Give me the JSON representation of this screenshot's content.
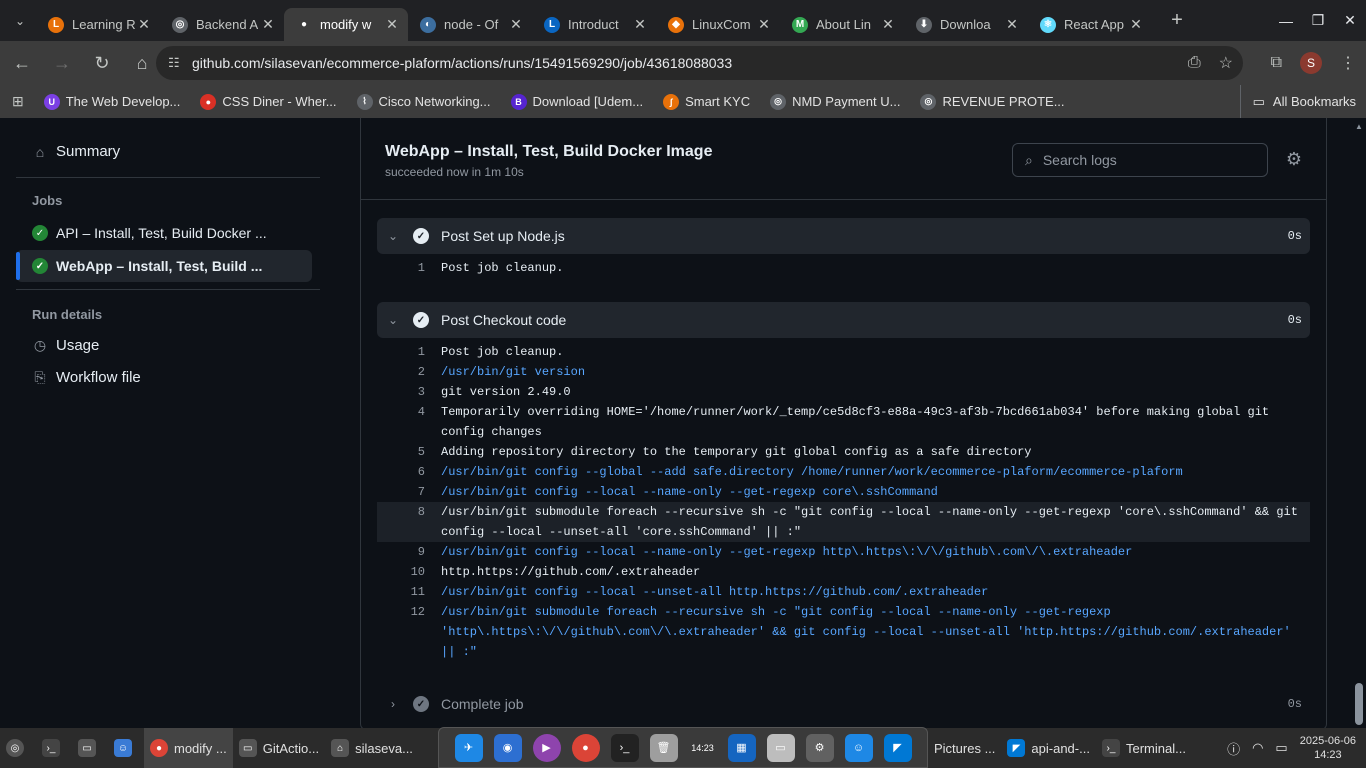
{
  "browser": {
    "tabs": [
      {
        "title": "Learning R",
        "color": "#e8710a",
        "glyph": "L",
        "active": false
      },
      {
        "title": "Backend A",
        "color": "#5f6368",
        "glyph": "◎",
        "active": false
      },
      {
        "title": "modify w",
        "color": "#ffffff",
        "glyph": "●",
        "active": true
      },
      {
        "title": "node - Of",
        "color": "#3c6e9f",
        "glyph": "◐",
        "active": false
      },
      {
        "title": "Introduct",
        "color": "#0a66c2",
        "glyph": "L",
        "active": false
      },
      {
        "title": "LinuxCom",
        "color": "#e8710a",
        "glyph": "◆",
        "active": false
      },
      {
        "title": "About Lin",
        "color": "#34a853",
        "glyph": "M",
        "active": false
      },
      {
        "title": "Downloa",
        "color": "#5f6368",
        "glyph": "⬇",
        "active": false
      },
      {
        "title": "React App",
        "color": "#61dafb",
        "glyph": "⚛",
        "active": false
      }
    ],
    "url": "github.com/silasevan/ecommerce-plaform/actions/runs/15491569290/job/43618088033",
    "profile_initial": "S",
    "bookmarks": [
      {
        "label": "The Web Develop...",
        "color": "#7b3fe4",
        "glyph": "U"
      },
      {
        "label": "CSS Diner - Wher...",
        "color": "#d93025",
        "glyph": "●"
      },
      {
        "label": "Cisco Networking...",
        "color": "#5f6368",
        "glyph": "⌇"
      },
      {
        "label": "Download [Udem...",
        "color": "#5624d0",
        "glyph": "B"
      },
      {
        "label": "Smart KYC",
        "color": "#e8710a",
        "glyph": "∫"
      },
      {
        "label": "NMD Payment U...",
        "color": "#5f6368",
        "glyph": "◎"
      },
      {
        "label": "REVENUE PROTE...",
        "color": "#5f6368",
        "glyph": "◎"
      }
    ],
    "all_bookmarks": "All Bookmarks"
  },
  "sidebar": {
    "summary": "Summary",
    "jobs_heading": "Jobs",
    "jobs": [
      {
        "label": "API – Install, Test, Build Docker ...",
        "selected": false
      },
      {
        "label": "WebApp – Install, Test, Build ...",
        "selected": true
      }
    ],
    "run_details_heading": "Run details",
    "usage": "Usage",
    "workflow_file": "Workflow file"
  },
  "job": {
    "title": "WebApp – Install, Test, Build Docker Image",
    "status": "succeeded now in 1m 10s",
    "search_placeholder": "Search logs"
  },
  "steps": [
    {
      "name": "Post Set up Node.js",
      "duration": "0s",
      "expanded": true,
      "lines": [
        {
          "n": "1",
          "text": "Post job cleanup.",
          "cmd": false
        }
      ]
    },
    {
      "name": "Post Checkout code",
      "duration": "0s",
      "expanded": true,
      "lines": [
        {
          "n": "1",
          "text": "Post job cleanup.",
          "cmd": false
        },
        {
          "n": "2",
          "text": "/usr/bin/git version",
          "cmd": true
        },
        {
          "n": "3",
          "text": "git version 2.49.0",
          "cmd": false
        },
        {
          "n": "4",
          "text": "Temporarily overriding HOME='/home/runner/work/_temp/ce5d8cf3-e88a-49c3-af3b-7bcd661ab034' before making global git config changes",
          "cmd": false
        },
        {
          "n": "5",
          "text": "Adding repository directory to the temporary git global config as a safe directory",
          "cmd": false
        },
        {
          "n": "6",
          "text": "/usr/bin/git config --global --add safe.directory /home/runner/work/ecommerce-plaform/ecommerce-plaform",
          "cmd": true
        },
        {
          "n": "7",
          "text": "/usr/bin/git config --local --name-only --get-regexp core\\.sshCommand",
          "cmd": true
        },
        {
          "n": "8",
          "text": "/usr/bin/git submodule foreach --recursive sh -c \"git config --local --name-only --get-regexp 'core\\.sshCommand' && git config --local --unset-all 'core.sshCommand' || :\"",
          "cmd": false
        },
        {
          "n": "9",
          "text": "/usr/bin/git config --local --name-only --get-regexp http\\.https\\:\\/\\/github\\.com\\/\\.extraheader",
          "cmd": true
        },
        {
          "n": "10",
          "text": "http.https://github.com/.extraheader",
          "cmd": false
        },
        {
          "n": "11",
          "text": "/usr/bin/git config --local --unset-all http.https://github.com/.extraheader",
          "cmd": true
        },
        {
          "n": "12",
          "text": "/usr/bin/git submodule foreach --recursive sh -c \"git config --local --name-only --get-regexp 'http\\.https\\:\\/\\/github\\.com\\/\\.extraheader' && git config --local --unset-all 'http.https://github.com/.extraheader' || :\"",
          "cmd": true
        }
      ]
    },
    {
      "name": "Complete job",
      "duration": "0s",
      "expanded": false,
      "lines": []
    }
  ],
  "taskbar": {
    "items": [
      {
        "label": "modify ...",
        "active": true
      },
      {
        "label": "GitActio...",
        "active": false
      },
      {
        "label": "silaseva...",
        "active": false
      },
      {
        "label": "Pictures ...",
        "active": false
      },
      {
        "label": "api-and-...",
        "active": false
      },
      {
        "label": "Terminal...",
        "active": false
      }
    ],
    "dock_clock": "14:23",
    "date": "2025-06-06",
    "time": "14:23"
  }
}
